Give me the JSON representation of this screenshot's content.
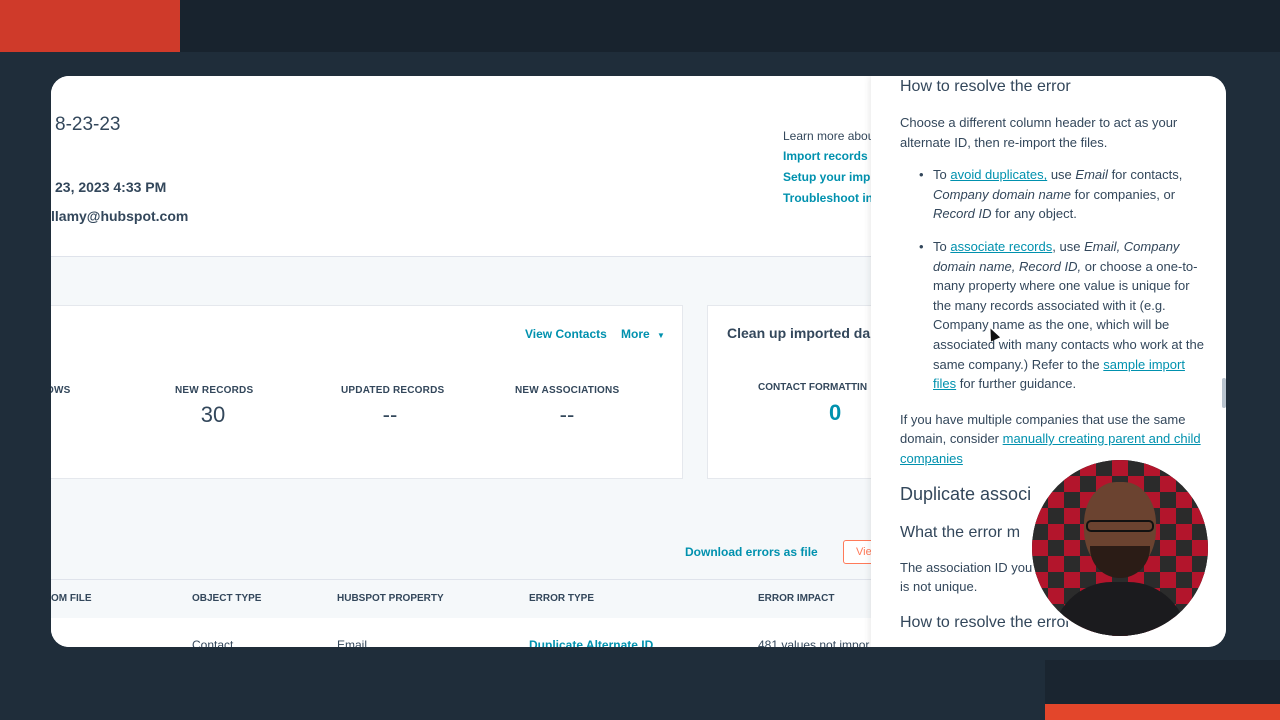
{
  "header": {
    "title": "8-23-23",
    "date": "23, 2023 4:33 PM",
    "user": "llamy@hubspot.com",
    "learn_more": "Learn more abou",
    "links": [
      "Import records",
      "Setup your imp",
      "Troubleshoot in"
    ]
  },
  "summary": {
    "view_contacts": "View Contacts",
    "more": "More",
    "stats": [
      {
        "label": "OWS",
        "value": ""
      },
      {
        "label": "NEW RECORDS",
        "value": "30"
      },
      {
        "label": "UPDATED RECORDS",
        "value": "--"
      },
      {
        "label": "NEW ASSOCIATIONS",
        "value": "--"
      }
    ]
  },
  "cleanup": {
    "title": "Clean up imported da",
    "label": "CONTACT FORMATTIN",
    "value": "0"
  },
  "errors": {
    "download_label": "Download errors as file",
    "view_label": "Vie",
    "columns": [
      "OM FILE",
      "OBJECT TYPE",
      "HUBSPOT PROPERTY",
      "ERROR TYPE",
      "ERROR IMPACT"
    ],
    "row": [
      "Contact",
      "Email",
      "Duplicate Alternate ID",
      "481 values not impor"
    ]
  },
  "article": {
    "resolve_heading": "How to resolve the error",
    "intro": "Choose a different column header to act as your alternate ID, then re-import the files.",
    "b1": {
      "to": "To",
      "link": "avoid duplicates,",
      "t1": "use",
      "em1": "Email",
      "t2": "for contacts,",
      "em2": "Company domain name",
      "t3": "for companies, or",
      "em3": "Record ID",
      "t4": "for any object."
    },
    "b2": {
      "to": "To",
      "link": "associate records",
      "t1": ", use",
      "em1": "Email, Company domain name, Record ID,",
      "t2": "or choose a one-to-many property where one value is unique for the many records associated with it (e.g. Company name as the one, which will be associated with many contacts who work at the same company.) Refer to the",
      "link2": "sample import files",
      "t3": "for further guidance."
    },
    "p2": {
      "t1": "If you have multiple companies that use the same domain, consider",
      "link": "manually creating parent and child companies"
    },
    "dup_heading": "Duplicate associ",
    "meaning_heading": "What the error m",
    "dup_text": "The association ID you records is not unique.",
    "resolve_heading_2": "How to resolve the error"
  }
}
